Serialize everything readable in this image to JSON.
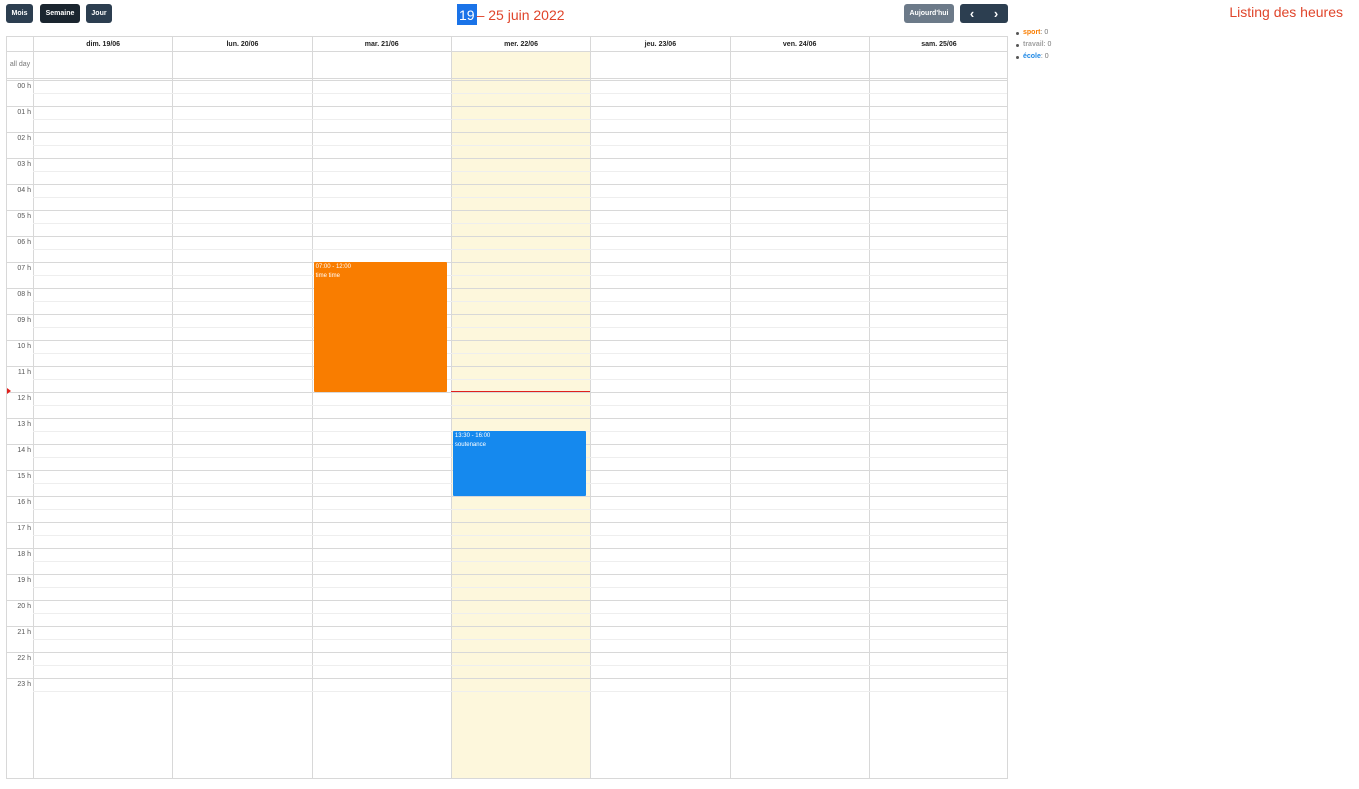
{
  "toolbar": {
    "view_buttons": [
      "Mois",
      "Semaine",
      "Jour"
    ],
    "title_highlight": "19",
    "title_rest": " – 25 juin 2022",
    "today_label": "Aujourd'hui",
    "prev_icon": "‹",
    "next_icon": "›"
  },
  "sidebar": {
    "title": "Listing des heures",
    "legend": [
      {
        "name": "sport",
        "count": " : 0",
        "color": "#f97d00"
      },
      {
        "name": "travail",
        "count": " : 0",
        "color": "#a0a0a0"
      },
      {
        "name": "école",
        "count": " : 0",
        "color": "#1e88e5"
      }
    ]
  },
  "calendar": {
    "days": [
      "dim. 19/06",
      "lun. 20/06",
      "mar. 21/06",
      "mer. 22/06",
      "jeu. 23/06",
      "ven. 24/06",
      "sam. 25/06"
    ],
    "allday_label": "all day",
    "hours": [
      "00 h",
      "01 h",
      "02 h",
      "03 h",
      "04 h",
      "05 h",
      "06 h",
      "07 h",
      "08 h",
      "09 h",
      "10 h",
      "11 h",
      "12 h",
      "13 h",
      "14 h",
      "15 h",
      "16 h",
      "17 h",
      "18 h",
      "19 h",
      "20 h",
      "21 h",
      "22 h",
      "23 h"
    ],
    "today_index": 3,
    "now_hour": 11.95,
    "events": [
      {
        "day": 2,
        "start": 7.0,
        "end": 12.0,
        "time": "07:00 - 12:00",
        "title": "time time",
        "color": "#f97d00"
      },
      {
        "day": 3,
        "start": 13.5,
        "end": 16.0,
        "time": "13:30 - 16:00",
        "title": "soutenance",
        "color": "#1589ee"
      }
    ]
  }
}
